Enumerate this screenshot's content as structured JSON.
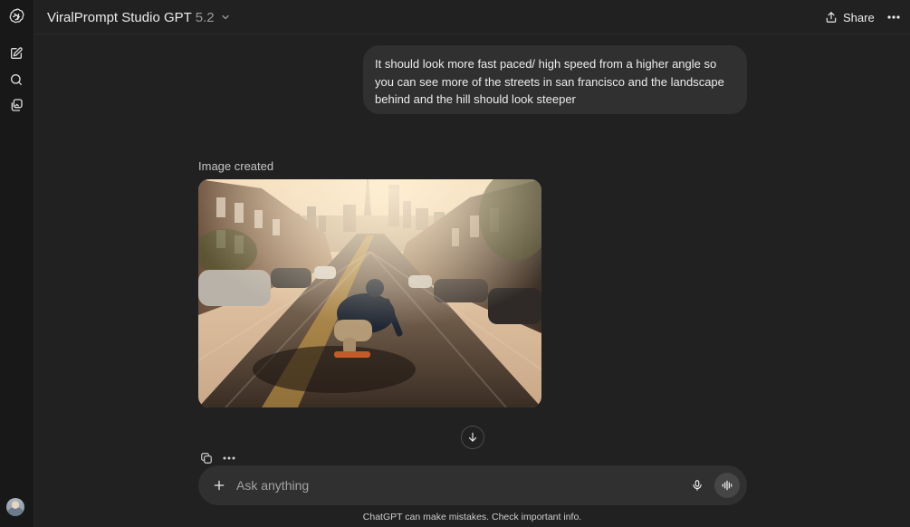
{
  "header": {
    "model_name": "ViralPrompt Studio GPT",
    "model_version": "5.2",
    "share_label": "Share"
  },
  "sidebar": {
    "icons": [
      "openai-logo-icon",
      "new-chat-icon",
      "search-icon",
      "library-icon"
    ],
    "avatar": "user-avatar"
  },
  "conversation": {
    "user_message": "It should look more fast paced/ high speed from a higher angle so you can see more of the streets in san francisco and the landscape behind and the hill should look steeper",
    "assistant_label": "Image created",
    "image_subject": "skateboarder"
  },
  "composer": {
    "placeholder": "Ask anything"
  },
  "footer": {
    "disclaimer": "ChatGPT can make mistakes. Check important info."
  },
  "colors": {
    "background": "#212121",
    "sidebar": "#181818",
    "bubble": "#303030",
    "text": "#ececec",
    "muted": "#9b9b9b"
  }
}
